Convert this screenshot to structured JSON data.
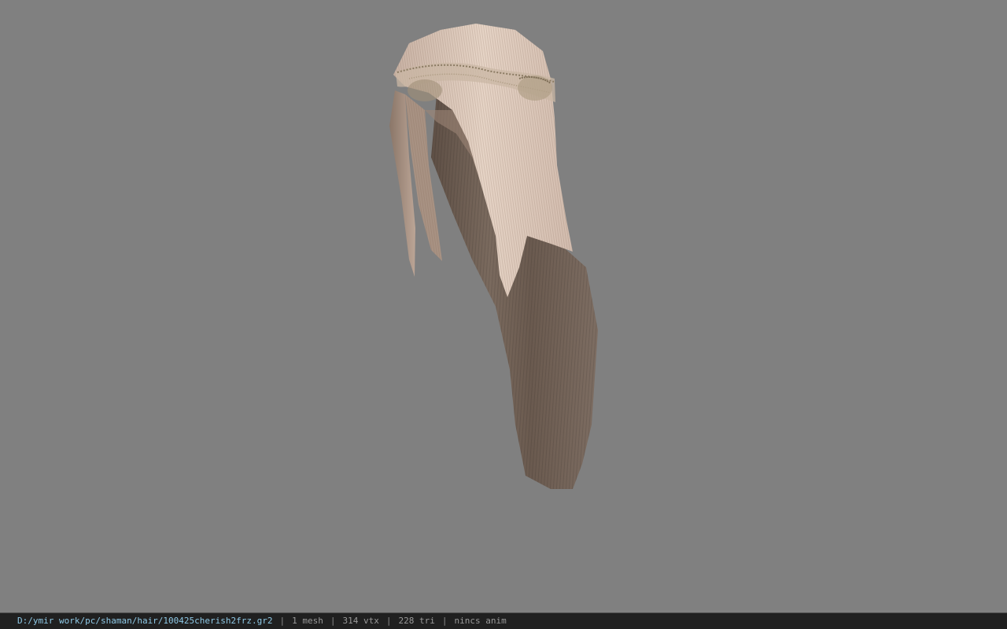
{
  "viewer": {
    "background_color": "#808080",
    "model": {
      "description_icon": "hair-mesh-model"
    }
  },
  "statusbar": {
    "file_path": "D:/ymir work/pc/shaman/hair/100425cherish2frz.gr2",
    "separator": "|",
    "mesh_count": "1 mesh",
    "vertex_count": "314 vtx",
    "triangle_count": "228 tri",
    "anim_info": "nincs anim",
    "path_color": "#8fc9e6",
    "text_color": "#9a9a9a"
  }
}
